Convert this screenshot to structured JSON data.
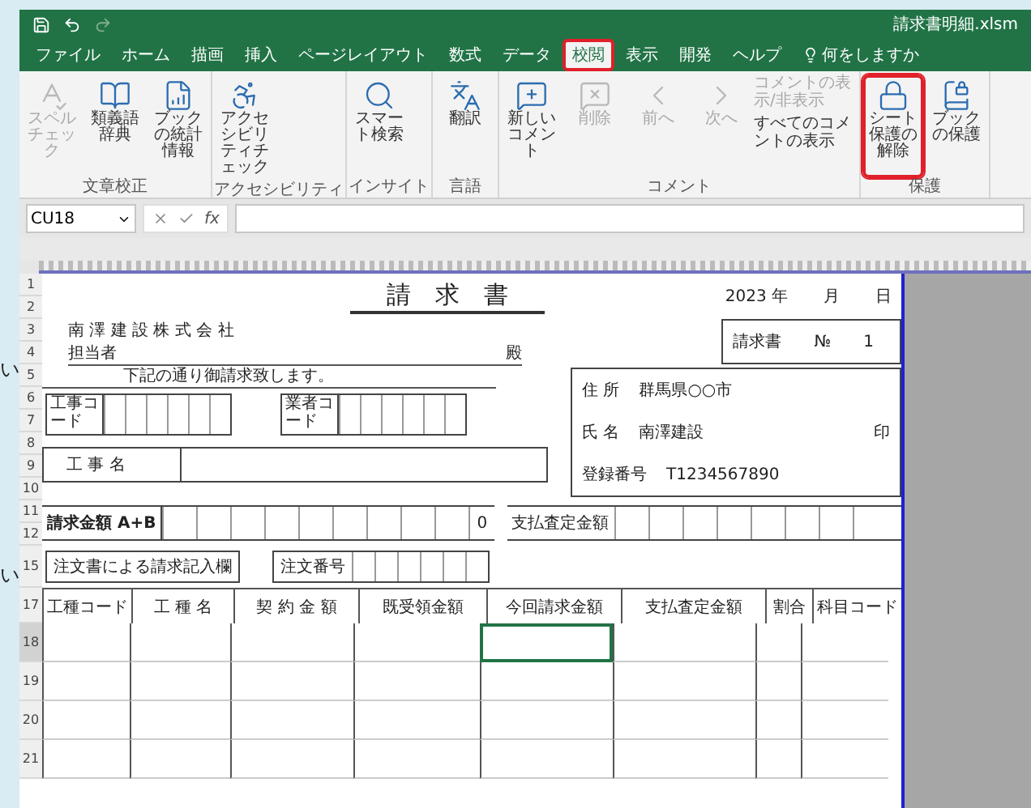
{
  "margin_texts": [
    "い",
    "い"
  ],
  "window": {
    "title": "請求書明細.xlsm"
  },
  "tabs": [
    {
      "label": "ファイル",
      "selected": false,
      "highlighted": false
    },
    {
      "label": "ホーム",
      "selected": false,
      "highlighted": false
    },
    {
      "label": "描画",
      "selected": false,
      "highlighted": false
    },
    {
      "label": "挿入",
      "selected": false,
      "highlighted": false
    },
    {
      "label": "ページレイアウト",
      "selected": false,
      "highlighted": false
    },
    {
      "label": "数式",
      "selected": false,
      "highlighted": false
    },
    {
      "label": "データ",
      "selected": false,
      "highlighted": false
    },
    {
      "label": "校閲",
      "selected": true,
      "highlighted": true
    },
    {
      "label": "表示",
      "selected": false,
      "highlighted": false
    },
    {
      "label": "開発",
      "selected": false,
      "highlighted": false
    },
    {
      "label": "ヘルプ",
      "selected": false,
      "highlighted": false
    }
  ],
  "tell_me": "何をしますか",
  "ribbon": {
    "groups": [
      {
        "label": "文章校正",
        "buttons": [
          {
            "label": "スペルチェック",
            "kind": "large",
            "disabled": true,
            "highlighted": false
          },
          {
            "label": "類義語辞典",
            "kind": "large",
            "disabled": false,
            "highlighted": false
          },
          {
            "label": "ブックの統計情報",
            "kind": "large",
            "disabled": false,
            "highlighted": false
          }
        ]
      },
      {
        "label": "アクセシビリティ",
        "buttons": [
          {
            "label": "アクセシビリティチェック",
            "kind": "large",
            "disabled": false,
            "highlighted": false
          }
        ]
      },
      {
        "label": "インサイト",
        "buttons": [
          {
            "label": "スマート検索",
            "kind": "large",
            "disabled": false,
            "highlighted": false
          }
        ]
      },
      {
        "label": "言語",
        "buttons": [
          {
            "label": "翻訳",
            "kind": "large",
            "disabled": false,
            "highlighted": false
          }
        ]
      },
      {
        "label": "コメント",
        "buttons": [
          {
            "label": "新しいコメント",
            "kind": "large",
            "disabled": false,
            "highlighted": false
          },
          {
            "label": "削除",
            "kind": "large",
            "disabled": true,
            "highlighted": false
          },
          {
            "label": "前へ",
            "kind": "large",
            "disabled": true,
            "highlighted": false
          },
          {
            "label": "次へ",
            "kind": "large",
            "disabled": true,
            "highlighted": false
          },
          {
            "label": "コメントの表示/非表示",
            "kind": "small",
            "disabled": true
          },
          {
            "label": "すべてのコメントの表示",
            "kind": "small",
            "disabled": false
          }
        ]
      },
      {
        "label": "保護",
        "buttons": [
          {
            "label": "シート保護の解除",
            "kind": "large",
            "disabled": false,
            "highlighted": true
          },
          {
            "label": "ブックの保護",
            "kind": "large",
            "disabled": false,
            "highlighted": false
          }
        ]
      }
    ]
  },
  "formula_bar": {
    "name_box": "CU18",
    "fx_label": "fx"
  },
  "row_numbers": [
    {
      "label": "1",
      "selected": false
    },
    {
      "label": "2",
      "selected": false
    },
    {
      "label": "3",
      "selected": false
    },
    {
      "label": "4",
      "selected": false
    },
    {
      "label": "5",
      "selected": false
    },
    {
      "label": "6",
      "selected": false
    },
    {
      "label": "7",
      "selected": false
    },
    {
      "label": "8",
      "selected": false
    },
    {
      "label": "9",
      "selected": false
    },
    {
      "label": "10",
      "selected": false
    },
    {
      "label": "11",
      "selected": false
    },
    {
      "label": "12",
      "selected": false
    },
    {
      "label": "15",
      "selected": false
    },
    {
      "label": "17",
      "selected": false
    },
    {
      "label": "18",
      "selected": true
    },
    {
      "label": "19",
      "selected": false
    },
    {
      "label": "20",
      "selected": false
    },
    {
      "label": "21",
      "selected": false
    }
  ],
  "form": {
    "title": "請　求　書",
    "year": "2023",
    "year_label": "年",
    "month_label": "月",
    "day_label": "日",
    "recipient": "南 澤 建 設 株 式 会 社",
    "attn_label": "担当者",
    "honorific": "殿",
    "invoice_label": "請求書",
    "invoice_no_label": "№",
    "invoice_no": "1",
    "notice": "下記の通り御請求致します。",
    "code_boxes": [
      "工事コード",
      "業者コード"
    ],
    "sender": {
      "address_label": "住 所",
      "address": "群馬県○○市",
      "name_label": "氏 名",
      "name": "南澤建設",
      "reg_label": "登録番号",
      "reg": "T1234567890",
      "seal": "印"
    },
    "project_label": "工 事 名",
    "amount_label": "請求金額 A+B",
    "amount_value": "0",
    "assessed_label": "支払査定金額",
    "order_label": "注文書による請求記入欄",
    "order_no_label": "注文番号"
  },
  "table": {
    "columns": [
      {
        "label": "工種コード",
        "active": false
      },
      {
        "label": "工 種 名",
        "active": false
      },
      {
        "label": "契 約 金 額",
        "active": false
      },
      {
        "label": "既受領金額",
        "active": false
      },
      {
        "label": "今回請求金額",
        "active": true
      },
      {
        "label": "支払査定金額",
        "active": false
      },
      {
        "label": "割合",
        "active": false
      },
      {
        "label": "科目コード",
        "active": false
      }
    ],
    "rows": [
      {
        "selected": true
      },
      {
        "selected": false
      },
      {
        "selected": false
      },
      {
        "selected": false
      }
    ]
  }
}
